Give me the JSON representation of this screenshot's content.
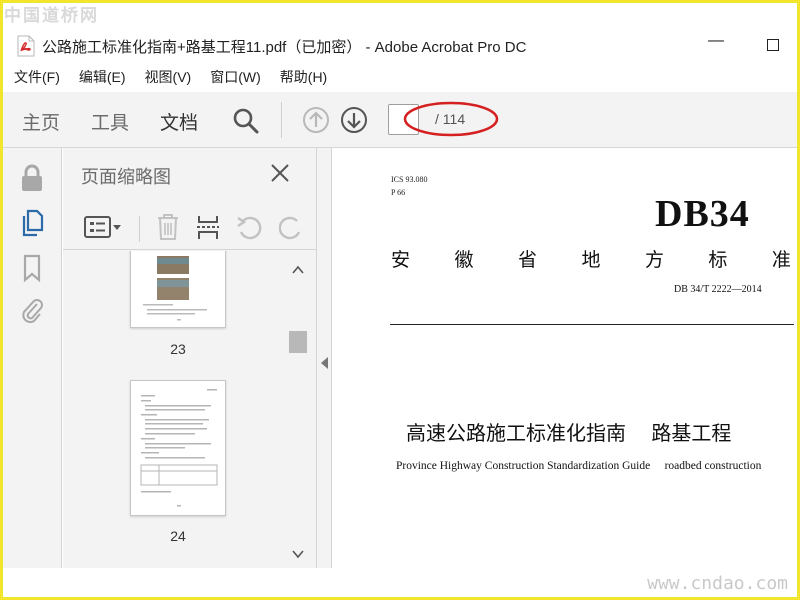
{
  "watermarks": {
    "top": "中国道桥网",
    "bottom": "www.cndao.com"
  },
  "window": {
    "title": "公路施工标准化指南+路基工程11.pdf（已加密） - Adobe Acrobat Pro DC",
    "minimize": "—"
  },
  "menu": {
    "items": [
      "文件(F)",
      "编辑(E)",
      "视图(V)",
      "窗口(W)",
      "帮助(H)"
    ]
  },
  "toolbar": {
    "tabs": [
      "主页",
      "工具",
      "文档"
    ],
    "active_tab": "文档",
    "page_current": "",
    "page_total": "/ 114"
  },
  "thumbnail_panel": {
    "title": "页面缩略图",
    "pages": [
      {
        "label": "23"
      },
      {
        "label": "24"
      }
    ]
  },
  "document": {
    "ics": "ICS 93.080",
    "p": "P 66",
    "db": "DB34",
    "province_chars": [
      "安",
      "徽",
      "省",
      "地",
      "方",
      "标",
      "准"
    ],
    "standard_no": "DB 34/T  2222—2014",
    "title_cn": "高速公路施工标准化指南    路基工程",
    "title_en": "Province Highway Construction Standardization Guide     roadbed construction"
  },
  "colors": {
    "accent": "#2d6aa8",
    "annotation_red": "#d42020",
    "frame": "#f3e52a"
  }
}
